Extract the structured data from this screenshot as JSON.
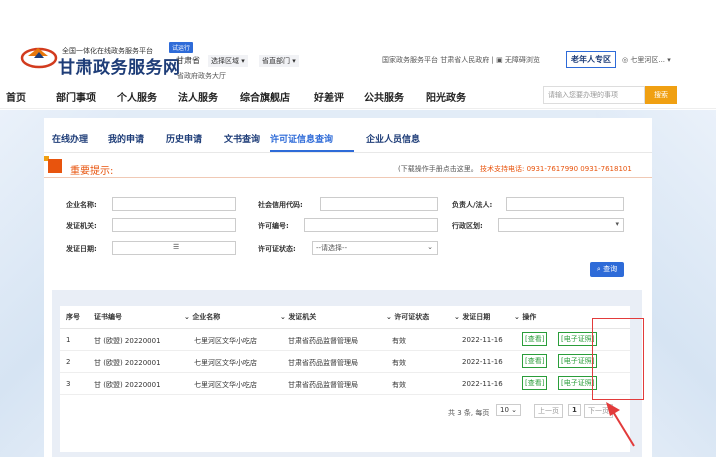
{
  "header": {
    "subtitle": "全国一体化在线政务服务平台",
    "title": "甘肃政务服务网",
    "trial": "试运行",
    "province": "甘肃省",
    "region_select": "选择区域",
    "dept_select": "省直部门",
    "hall": "省政府政务大厅",
    "links": [
      "国家政务服务平台",
      "甘肃省人民政府",
      "无障碍浏览"
    ],
    "elder": "老年人专区",
    "location": "七里河区..."
  },
  "nav": {
    "items": [
      "首页",
      "部门事项",
      "个人服务",
      "法人服务",
      "综合旗舰店",
      "好差评",
      "公共服务",
      "阳光政务"
    ],
    "search_placeholder": "请输入您要办理的事项",
    "search_button": "搜索"
  },
  "tabs": [
    "在线办理",
    "我的申请",
    "历史申请",
    "文书查询",
    "许可证信息查询",
    "企业人员信息"
  ],
  "notice": {
    "title": "重要提示:",
    "help_text": "(下载操作手册点击这里。",
    "support_label": "技术支持电话:",
    "support_phone": "0931-7617990 0931-7618101"
  },
  "form": {
    "company_name": "企业名称:",
    "credit_code": "社会信用代码:",
    "responsible": "负责人/法人:",
    "issuer": "发证机关:",
    "license_no": "许可编号:",
    "region": "行政区划:",
    "issue_date": "发证日期:",
    "license_status": "许可证状态:",
    "status_placeholder": "--请选择--",
    "query_button": "查询"
  },
  "table": {
    "headers": [
      "序号",
      "证书编号",
      "企业名称",
      "发证机关",
      "许可证状态",
      "发证日期",
      "操作"
    ],
    "rows": [
      {
        "no": "1",
        "cert": "甘 (欧盟) 20220001",
        "company": "七里河区文华小吃店",
        "issuer": "甘肃省药品监督管理局",
        "status": "有效",
        "date": "2022-11-16"
      },
      {
        "no": "2",
        "cert": "甘 (欧盟) 20220001",
        "company": "七里河区文华小吃店",
        "issuer": "甘肃省药品监督管理局",
        "status": "有效",
        "date": "2022-11-16"
      },
      {
        "no": "3",
        "cert": "甘 (欧盟) 20220001",
        "company": "七里河区文华小吃店",
        "issuer": "甘肃省药品监督管理局",
        "status": "有效",
        "date": "2022-11-16"
      }
    ],
    "view_btn": "[查看]",
    "ecert_btn": "[电子证照]"
  },
  "pager": {
    "total": "共 3 条, 每页",
    "per_page": "10",
    "prev": "上一页",
    "page": "1",
    "next": "下一页"
  }
}
